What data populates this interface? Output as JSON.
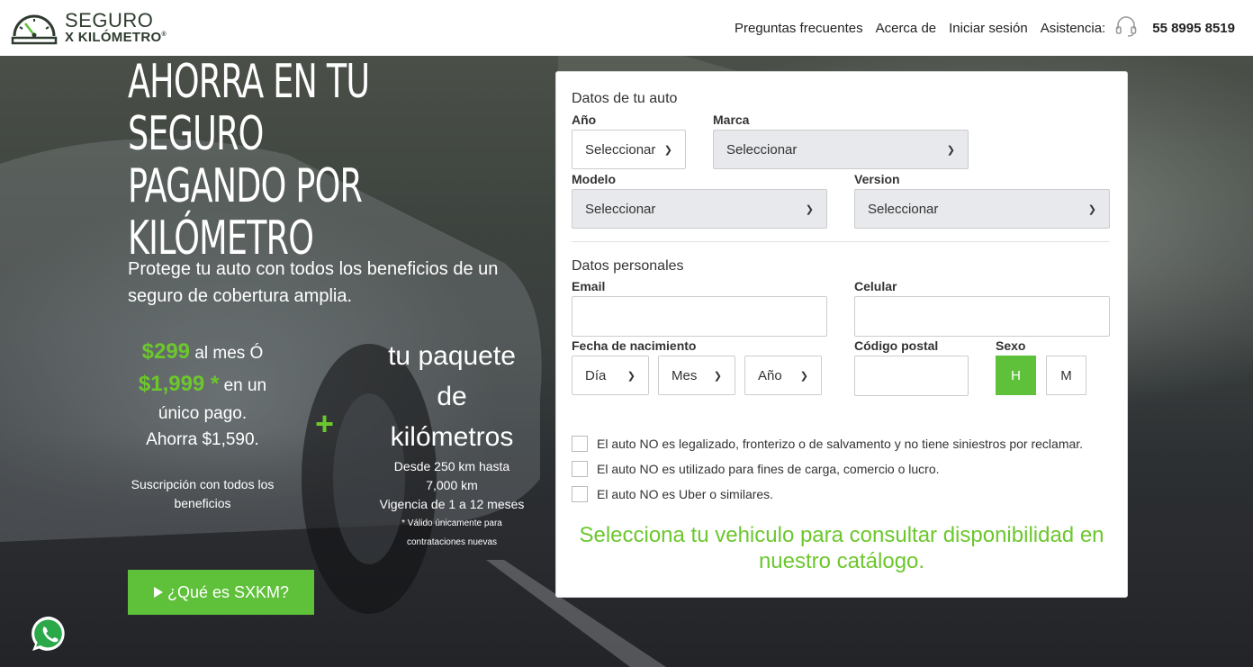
{
  "brand": {
    "line1": "SEGURO",
    "line2": "X KILÓMETRO",
    "registered": "®"
  },
  "nav": {
    "faq": "Preguntas frecuentes",
    "about": "Acerca de",
    "login": "Iniciar sesión",
    "assist_label": "Asistencia:",
    "phone": "55 8995 8519"
  },
  "hero": {
    "title_lines": [
      "Ahorra en tu seguro",
      "pagando por",
      "kilómetro"
    ],
    "subtitle": "Protege tu auto con todos los beneficios de un seguro de cobertura amplia.",
    "price_monthly": "$299",
    "price_monthly_suffix": "al mes Ó",
    "price_single": "$1,999 *",
    "price_single_suffix": "en un",
    "price_single_suffix2": "único pago.",
    "saving": "Ahorra $1,590.",
    "suscription": "Suscripción con todos los beneficios",
    "plus": "+",
    "package_line1": "tu paquete",
    "package_line2": "de",
    "package_line3": "kilómetros",
    "package_range1": "Desde 250 km hasta",
    "package_range2": "7,000 km",
    "package_validity": "Vigencia de 1 a 12 meses",
    "package_note1": "* Válido únicamente para",
    "package_note2": "contrataciones nuevas",
    "cta_label": "¿Qué es SXKM?"
  },
  "form": {
    "car_section": "Datos de tu auto",
    "year_label": "Año",
    "year_value": "Seleccionar",
    "brand_label": "Marca",
    "brand_value": "Seleccionar",
    "model_label": "Modelo",
    "model_value": "Seleccionar",
    "version_label": "Version",
    "version_value": "Seleccionar",
    "personal_section": "Datos personales",
    "email_label": "Email",
    "email_value": "",
    "phone_label": "Celular",
    "phone_value": "",
    "birth_label": "Fecha de nacimiento",
    "day_value": "Día",
    "month_value": "Mes",
    "birth_year_value": "Año",
    "zip_label": "Código postal",
    "zip_value": "",
    "sex_label": "Sexo",
    "sex_h": "H",
    "sex_m": "M",
    "checks": [
      "El auto NO es legalizado, fronterizo o de salvamento y no tiene siniestros por reclamar.",
      "El auto NO es utilizado para fines de carga, comercio o lucro.",
      "El auto NO es Uber o similares."
    ],
    "message": "Selecciona tu vehiculo para consultar disponibilidad en nuestro catálogo."
  },
  "colors": {
    "accent": "#5fc13a",
    "accent_text": "#6cc72d",
    "logo": "#2e3b2e"
  },
  "icons": [
    "speedometer-logo-icon",
    "headset-icon",
    "play-icon",
    "chevron-down-icon",
    "whatsapp-icon"
  ]
}
